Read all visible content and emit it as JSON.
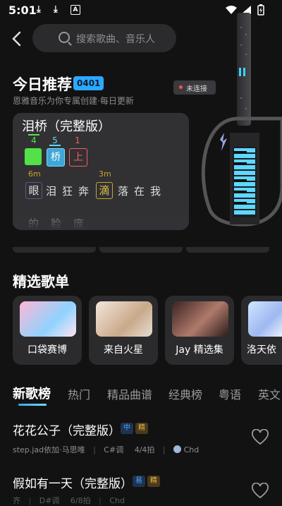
{
  "status": {
    "time": "5:01"
  },
  "search": {
    "placeholder": "搜索歌曲、音乐人"
  },
  "recommend": {
    "title": "今日推荐",
    "date_badge": "0401",
    "subtitle": "恩雅音乐为你专属创建·每日更新",
    "device_status": "未连接",
    "card": {
      "song": "泪桥（完整版）",
      "notes": [
        {
          "number": "4",
          "lyric": ""
        },
        {
          "number": "5",
          "lyric": "桥"
        },
        {
          "number": "1",
          "lyric": "上"
        }
      ],
      "time_marks": [
        "6m",
        "3m"
      ],
      "lyrics_row1": [
        "眼",
        "泪",
        "狂",
        "奔",
        "滴",
        "落",
        "在",
        "我"
      ],
      "lyrics_row2": [
        "的",
        "脸",
        "庞"
      ]
    }
  },
  "featured": {
    "title": "精选歌单",
    "playlists": [
      {
        "label": "口袋赛博"
      },
      {
        "label": "来自火星"
      },
      {
        "label": "Jay 精选集"
      },
      {
        "label": "洛天依"
      }
    ]
  },
  "tabs": [
    "新歌榜",
    "热门",
    "精品曲谱",
    "经典榜",
    "粤语",
    "英文"
  ],
  "songs": [
    {
      "title": "花花公子（完整版）",
      "tags": [
        "中",
        "精"
      ],
      "artist": "step.jad依加·马思唯",
      "key": "C#调",
      "meter": "4/4拍",
      "uploader": "Chd"
    },
    {
      "title": "假如有一天（完整版）",
      "tags": [
        "易",
        "精"
      ],
      "artist": "齐",
      "key": "D#调",
      "meter": "6/8拍",
      "uploader": "Chd"
    }
  ],
  "colors": {
    "accent": "#2ea8ff",
    "background": "#121212"
  }
}
